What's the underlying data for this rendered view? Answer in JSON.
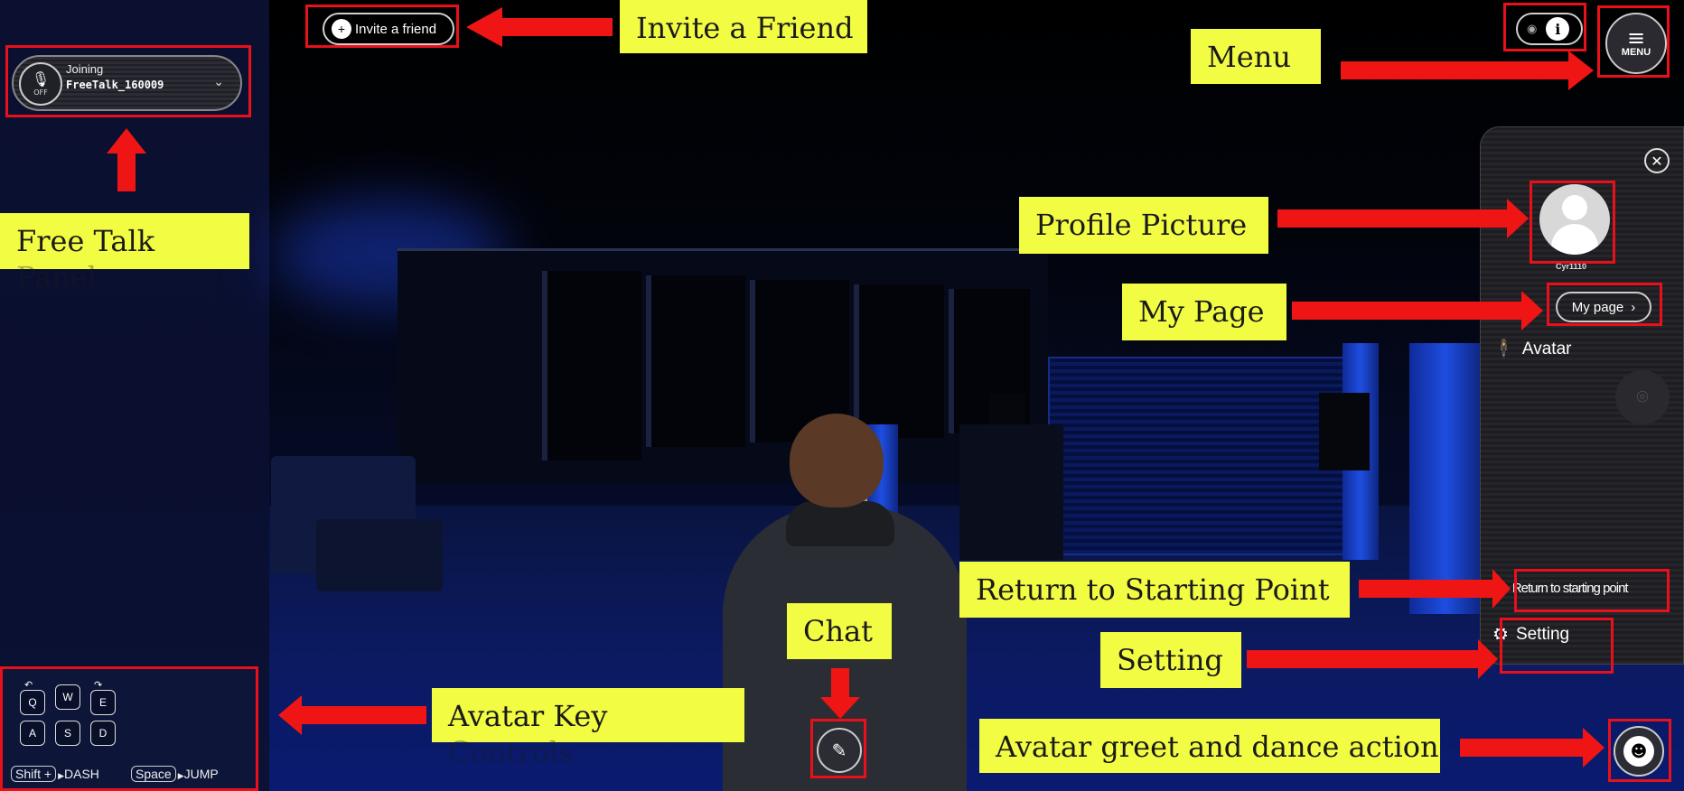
{
  "top_bar": {
    "invite_label": "Invite a friend"
  },
  "free_talk": {
    "mic_state": "OFF",
    "status": "Joining",
    "room_name": "FreeTalk_160009"
  },
  "key_controls": {
    "keys_top": [
      "Q",
      "W",
      "E"
    ],
    "keys_bottom": [
      "A",
      "S",
      "D"
    ],
    "dash_key": "Shift +",
    "dash_label": "DASH",
    "jump_key": "Space",
    "jump_label": "JUMP"
  },
  "menu": {
    "label": "MENU"
  },
  "side_panel": {
    "username": "Cyr1110",
    "my_page_label": "My page",
    "avatar_label": "Avatar",
    "return_label": "Return to starting point",
    "setting_label": "Setting"
  },
  "annotations": {
    "invite": "Invite a Friend",
    "menu": "Menu",
    "free_talk": "Free Talk",
    "free_talk_ghost": "Panel",
    "profile": "Profile Picture",
    "my_page": "My Page",
    "return": "Return to Starting Point",
    "chat": "Chat",
    "setting": "Setting",
    "key_controls": "Avatar Key",
    "key_controls_ghost": "Controls",
    "greet": "Avatar greet and dance action"
  },
  "colors": {
    "label_bg": "#f2fc43",
    "highlight_red": "#e8101a"
  }
}
